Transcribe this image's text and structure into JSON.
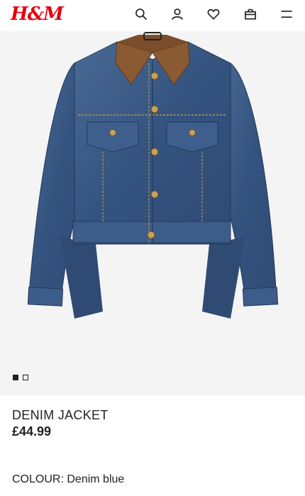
{
  "header": {
    "logo": "H&M",
    "icons": [
      "search-icon",
      "account-icon",
      "favourites-icon",
      "bag-icon",
      "menu-icon"
    ]
  },
  "gallery": {
    "image_alt": "Denim jacket with brown corduroy collar",
    "pages": 2,
    "active_page": 1
  },
  "product": {
    "name": "DENIM JACKET",
    "price": "£44.99",
    "colour_label": "COLOUR:",
    "colour_value": "Denim blue"
  },
  "colors": {
    "brand": "#e50010",
    "denim": "#3a5a86",
    "collar": "#8a5a33",
    "background": "#f4f4f4"
  }
}
